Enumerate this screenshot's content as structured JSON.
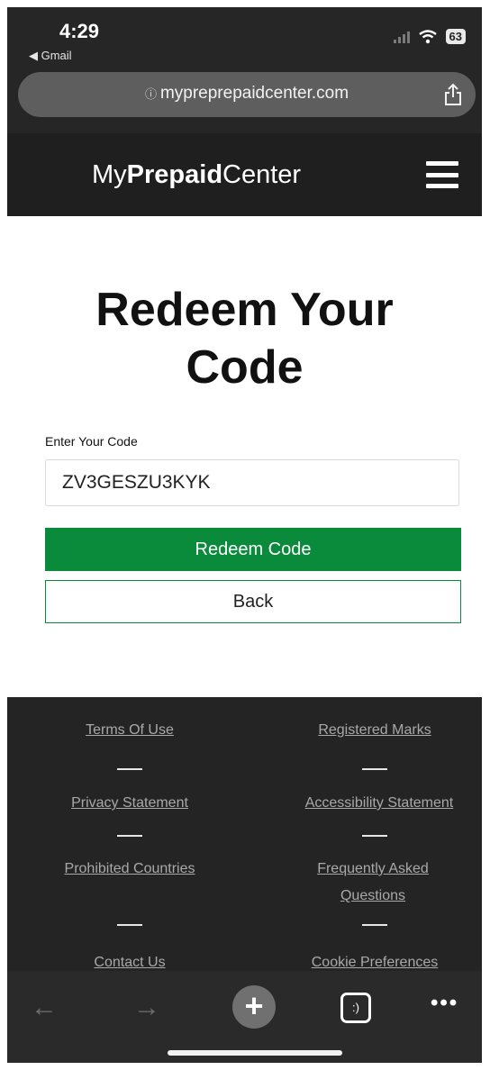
{
  "status": {
    "time": "4:29",
    "back_app": "◀ Gmail",
    "battery": "63"
  },
  "browser": {
    "url": "mypreprepaidcenter.com",
    "bottom_tab_count": ":)"
  },
  "site": {
    "logo_my": "My",
    "logo_prepaid": "Prepaid",
    "logo_center": "Center"
  },
  "main": {
    "title": "Redeem Your Code",
    "code_label": "Enter Your Code",
    "code_value": "ZV3GESZU3KYK",
    "redeem_label": "Redeem Code",
    "back_label": "Back"
  },
  "footer": {
    "terms": "Terms Of Use",
    "registered": "Registered Marks",
    "privacy": "Privacy Statement",
    "accessibility": "Accessibility Statement",
    "prohibited": "Prohibited Countries",
    "faq": "Frequently Asked Questions",
    "contact": "Contact Us",
    "cookie": "Cookie Preferences"
  },
  "colors": {
    "accent_green": "#0a8a3b",
    "header_dark": "#1f1f1f",
    "footer_dark": "#242424"
  }
}
